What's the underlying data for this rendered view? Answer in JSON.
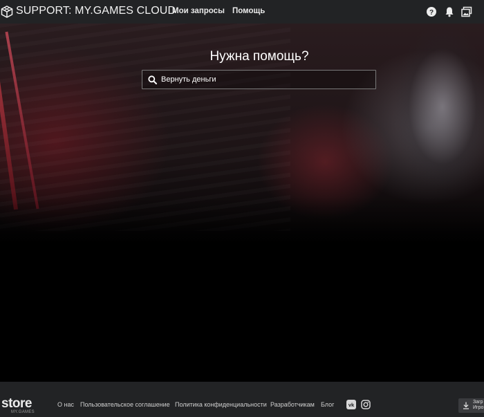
{
  "header": {
    "brand": "SUPPORT: MY.GAMES CLOUD",
    "nav": {
      "requests": "Мои запросы",
      "help": "Помощь"
    },
    "icons": [
      "cube-logo-icon",
      "help-circle-icon",
      "notification-bell-icon",
      "gallery-icon"
    ]
  },
  "hero": {
    "title": "Нужна помощь?",
    "search": {
      "value": "Вернуть деньги",
      "icon": "search-icon"
    }
  },
  "footer": {
    "logo": {
      "word": "store",
      "sub": "MY.GAMES"
    },
    "links": [
      "О нас",
      "Пользовательское соглашение",
      "Политика конфиденциальности",
      "Разработчикам",
      "Блог"
    ],
    "social": [
      "vk-icon",
      "instagram-icon"
    ],
    "download": {
      "line1": "Загр",
      "line2": "Игро",
      "icon": "download-icon"
    }
  },
  "colors": {
    "header_bg": "#222325",
    "footer_bg": "#222325",
    "page_bg": "#000000",
    "accent_red": "#c8404a"
  }
}
